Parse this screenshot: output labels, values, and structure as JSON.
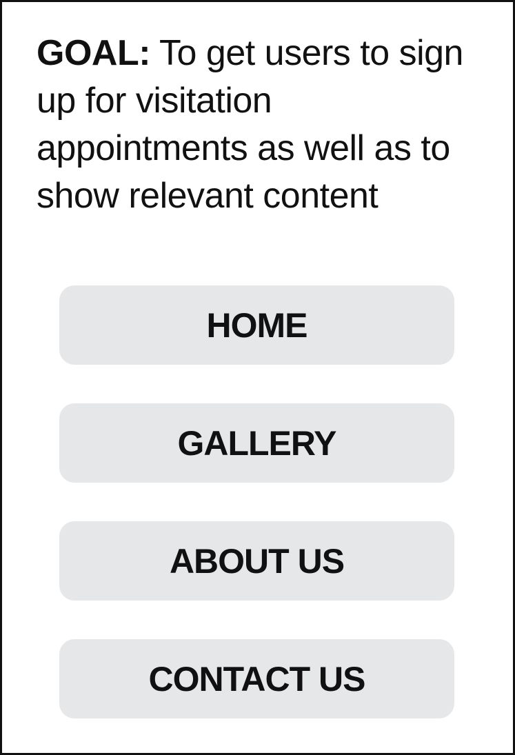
{
  "goal": {
    "label": "GOAL:",
    "text": "To get users to sign up for visitation appointments as well as to show relevant content"
  },
  "nav": {
    "items": [
      {
        "label": "HOME"
      },
      {
        "label": "GALLERY"
      },
      {
        "label": "ABOUT US"
      },
      {
        "label": "CONTACT US"
      }
    ]
  },
  "colors": {
    "button_bg": "#e6e7e9",
    "text": "#111111",
    "border": "#111111",
    "background": "#ffffff"
  }
}
